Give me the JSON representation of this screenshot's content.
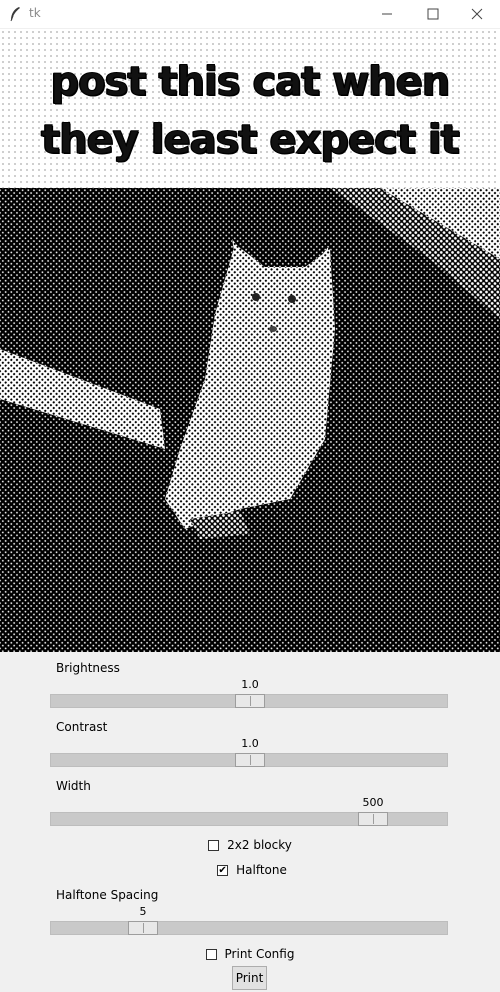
{
  "window": {
    "title": "tk"
  },
  "image": {
    "caption_lines": [
      "post this cat when",
      "they least expect it"
    ],
    "description": "halftone photo of a white kitten"
  },
  "controls": {
    "brightness": {
      "label": "Brightness",
      "value": "1.0"
    },
    "contrast": {
      "label": "Contrast",
      "value": "1.0"
    },
    "width": {
      "label": "Width",
      "value": "500"
    },
    "blocky": {
      "label": "2x2 blocky",
      "checked": false
    },
    "halftone": {
      "label": "Halftone",
      "checked": true
    },
    "halftone_spacing": {
      "label": "Halftone Spacing",
      "value": "5"
    },
    "print_config": {
      "label": "Print Config",
      "checked": false
    },
    "print_button": {
      "label": "Print"
    }
  },
  "icons": {
    "app": "feather-icon",
    "minimize": "minimize-icon",
    "maximize": "maximize-icon",
    "close": "close-icon"
  }
}
